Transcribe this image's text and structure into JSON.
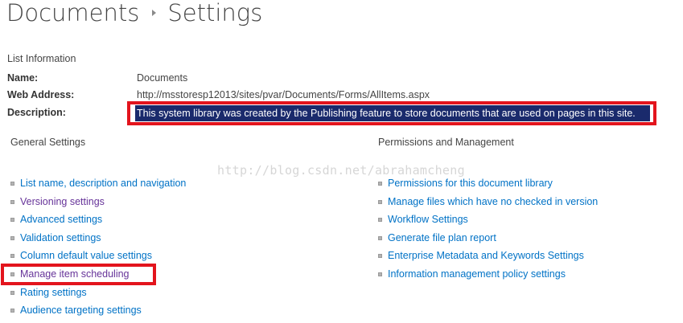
{
  "header": {
    "breadcrumb_parent": "Documents",
    "breadcrumb_current": "Settings"
  },
  "list_information": {
    "section_title": "List Information",
    "name_label": "Name:",
    "name_value": "Documents",
    "web_address_label": "Web Address:",
    "web_address_value": "http://msstoresp12013/sites/pvar/Documents/Forms/AllItems.aspx",
    "description_label": "Description:",
    "description_value": "This system library was created by the Publishing feature to store documents that are used on pages in this site."
  },
  "watermark": "http://blog.csdn.net/abrahamcheng",
  "general_settings": {
    "title": "General Settings",
    "links": [
      {
        "label": "List name, description and navigation",
        "visited": false
      },
      {
        "label": "Versioning settings",
        "visited": true
      },
      {
        "label": "Advanced settings",
        "visited": false
      },
      {
        "label": "Validation settings",
        "visited": false
      },
      {
        "label": "Column default value settings",
        "visited": false
      },
      {
        "label": "Manage item scheduling",
        "visited": true
      },
      {
        "label": "Rating settings",
        "visited": false
      },
      {
        "label": "Audience targeting settings",
        "visited": false
      }
    ]
  },
  "permissions_management": {
    "title": "Permissions and Management",
    "links": [
      {
        "label": "Permissions for this document library",
        "visited": false
      },
      {
        "label": "Manage files which have no checked in version",
        "visited": false
      },
      {
        "label": "Workflow Settings",
        "visited": false
      },
      {
        "label": "Generate file plan report",
        "visited": false
      },
      {
        "label": "Enterprise Metadata and Keywords Settings",
        "visited": false
      },
      {
        "label": "Information management policy settings",
        "visited": false
      }
    ]
  },
  "colors": {
    "link": "#0072c6",
    "visited_link": "#663399",
    "highlight_bg": "#1a2a6c",
    "annotation_red": "#e3141d"
  },
  "icons": {
    "separator": "breadcrumb-arrow-icon",
    "bullet": "square-bullet-icon"
  }
}
